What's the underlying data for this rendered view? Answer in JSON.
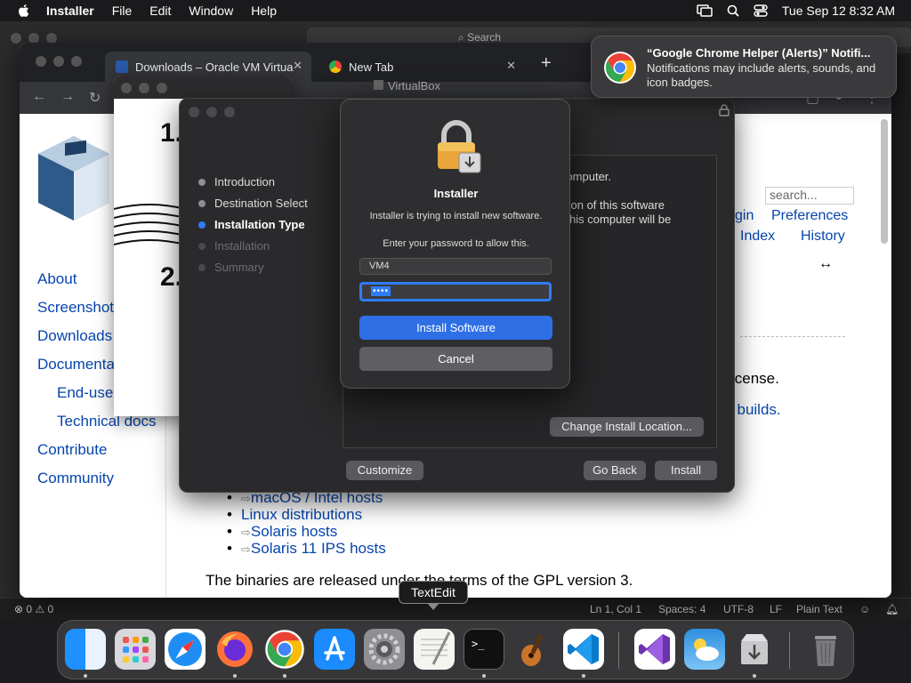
{
  "menubar": {
    "app_name": "Installer",
    "items": [
      "File",
      "Edit",
      "Window",
      "Help"
    ],
    "clock": "Tue Sep 12  8:32 AM"
  },
  "vscode": {
    "search_placeholder": "Search",
    "status": {
      "problems": "0",
      "warnings": "0",
      "position": "Ln 1, Col 1",
      "spaces": "Spaces: 4",
      "encoding": "UTF-8",
      "eol": "LF",
      "language": "Plain Text"
    }
  },
  "chrome": {
    "tabs": [
      {
        "label": "Downloads – Oracle VM Virtua"
      },
      {
        "label": "New Tab"
      }
    ],
    "page": {
      "search_placeholder": "search...",
      "top_links": [
        "gin",
        "Preferences",
        "Index",
        "History"
      ],
      "sidebar_links": [
        "About",
        "Screenshots",
        "Downloads",
        "Documentation",
        "End-user docs",
        "Technical docs",
        "Contribute",
        "Community"
      ],
      "license_text": "icense.",
      "builds_link": "l builds.",
      "bullets": [
        "macOS / Intel hosts",
        "Linux distributions",
        "Solaris hosts",
        "Solaris 11 IPS hosts"
      ],
      "gpl_text": "The binaries are released under the terms of the GPL version 3."
    }
  },
  "virtualbox_window": {
    "title": "VirtualBox",
    "steps": [
      "1.",
      "2."
    ]
  },
  "installer": {
    "steps": [
      {
        "label": "Introduction",
        "state": "done"
      },
      {
        "label": "Destination Select",
        "state": "done"
      },
      {
        "label": "Installation Type",
        "state": "current"
      },
      {
        "label": "Installation",
        "state": "future"
      },
      {
        "label": "Summary",
        "state": "future"
      }
    ],
    "content_line1": "r computer.",
    "content_line2": "llation of this software",
    "content_line3": "of this computer will be",
    "change_location_button": "Change Install Location...",
    "customize_button": "Customize",
    "go_back_button": "Go Back",
    "install_button": "Install"
  },
  "dialog": {
    "title": "Installer",
    "subtitle": "Installer is trying to install new software.",
    "prompt": "Enter your password to allow this.",
    "username": "VM4",
    "password_mask": "••••",
    "install_button": "Install Software",
    "cancel_button": "Cancel"
  },
  "notification": {
    "title": "“Google Chrome Helper (Alerts)” Notifi...",
    "body": "Notifications may include alerts, sounds, and icon badges."
  },
  "tooltip": "TextEdit",
  "dock": {
    "apps": [
      "Finder",
      "Launchpad",
      "Safari",
      "Firefox",
      "Google Chrome",
      "App Store",
      "System Settings",
      "TextEdit",
      "Terminal",
      "GarageBand",
      "Visual Studio Code",
      "Visual Studio",
      "Weather",
      "Installer",
      "Trash"
    ]
  },
  "colors": {
    "accent": "#2e6fe6",
    "link": "#0645ad"
  }
}
